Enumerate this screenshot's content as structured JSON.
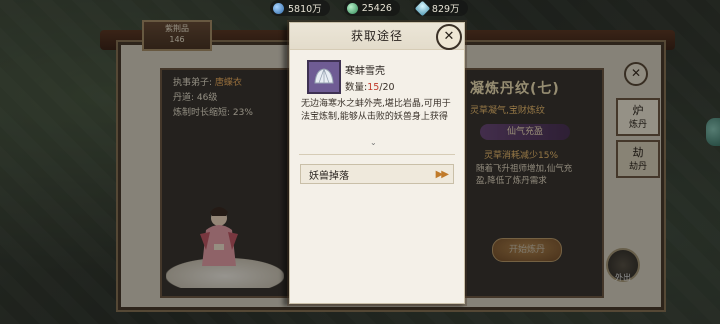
{
  "resources": [
    {
      "icon": "blue-orb-icon",
      "value": "5810万"
    },
    {
      "icon": "jade-coin-icon",
      "value": "25426"
    },
    {
      "icon": "crystal-icon",
      "value": "829万"
    }
  ],
  "background": {
    "level_badge": {
      "label": "紫荆品",
      "value": "146"
    },
    "disciple": {
      "label": "执事弟子:",
      "value": "唐蝶衣"
    },
    "pill_level": {
      "label": "丹道:",
      "value": "46级"
    },
    "time_reduce": {
      "label": "炼制时长缩短:",
      "value": "23%"
    },
    "recipe_title": "凝炼丹纹(七)",
    "recipe_sub": "灵草凝气,宝财炼纹",
    "buff_pill": "仙气充盈",
    "buff_effect": "灵草消耗减少15%",
    "buff_desc": "随着飞升祖师增加,仙气充盈,降低了炼丹需求",
    "start_button": "开始炼丹",
    "outing_button": "外出",
    "tabs": [
      {
        "glyph": "炉",
        "label": "炼丹",
        "icon": "furnace-icon"
      },
      {
        "glyph": "劫",
        "label": "劫丹",
        "icon": "tribulation-icon"
      }
    ],
    "close_glyph": "✕"
  },
  "popup": {
    "title": "获取途径",
    "close_glyph": "✕",
    "item": {
      "icon": "clam-shell-icon",
      "name": "寒蚌雪壳",
      "qty_label": "数量:",
      "qty_current": "15",
      "qty_total": "/20",
      "description": "无边海寒水之蚌外壳,堪比岩晶,可用于法宝炼制,能够从击败的妖兽身上获得"
    },
    "more_glyph": "⌄",
    "sources": [
      {
        "label": "妖兽掉落",
        "arrow": "▶▶"
      }
    ]
  }
}
